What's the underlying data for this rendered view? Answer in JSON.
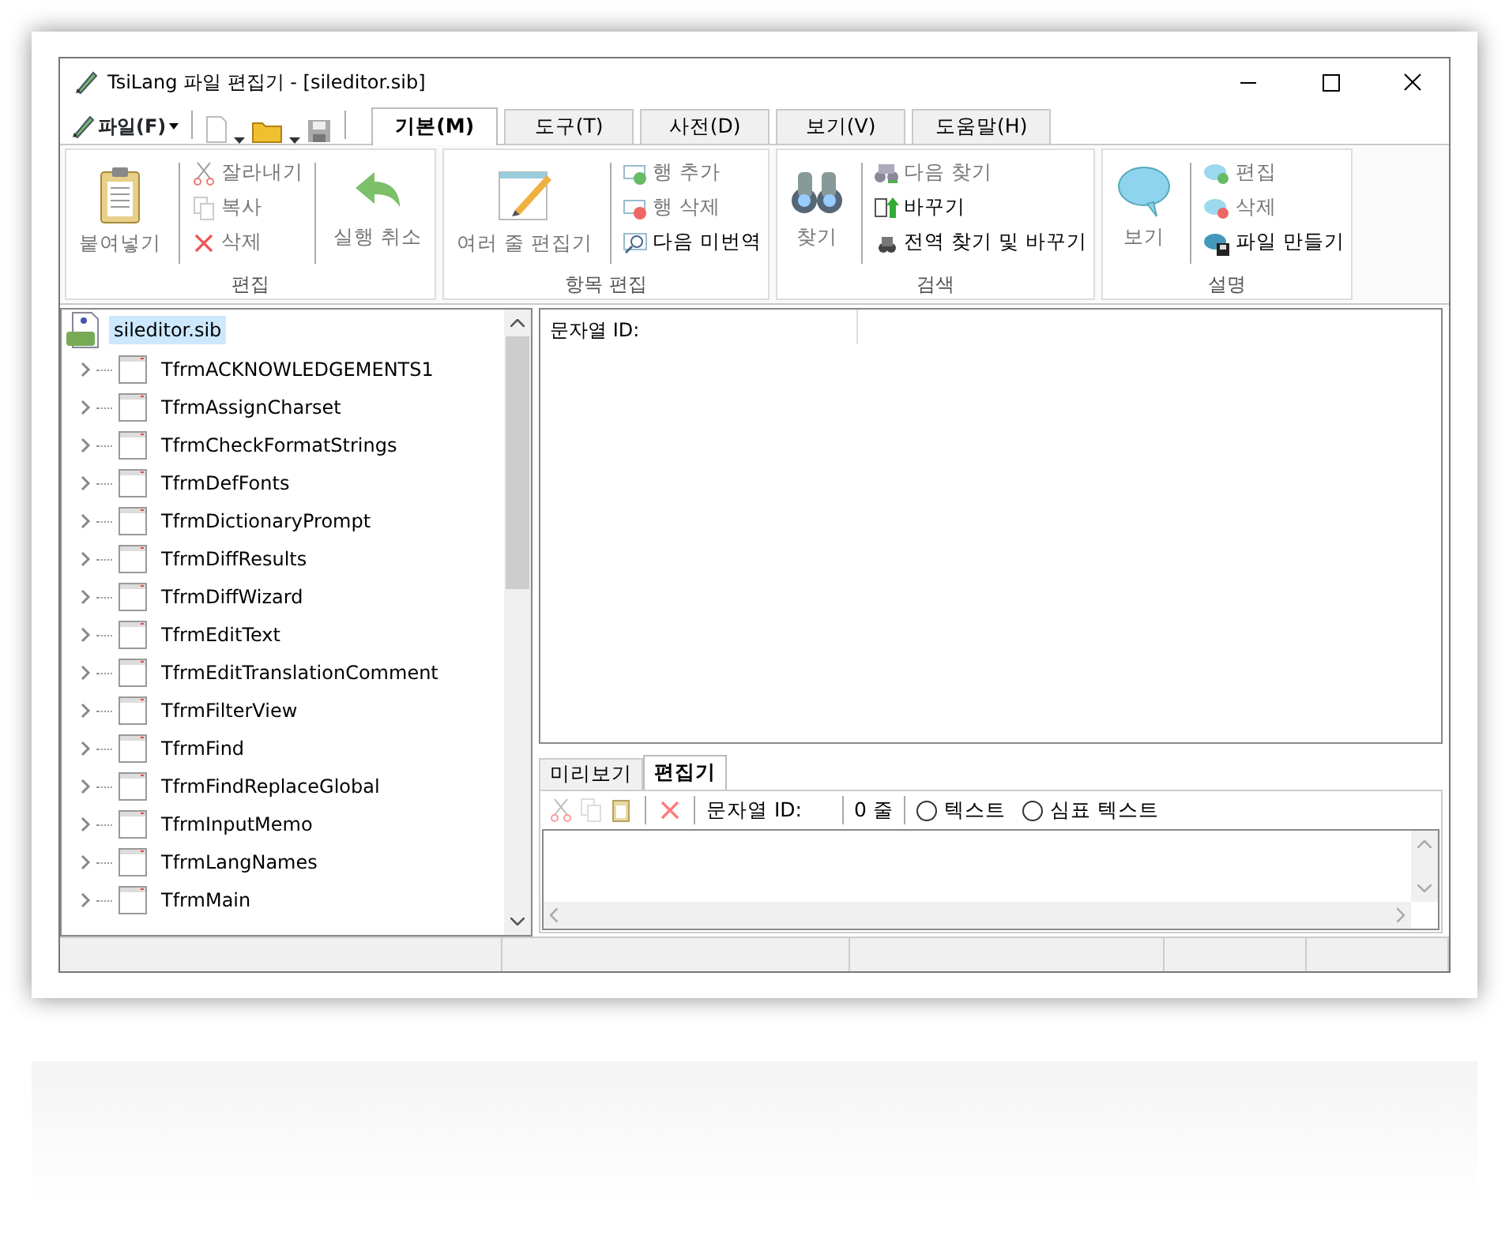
{
  "window": {
    "title": "TsiLang 파일 편집기 - [sileditor.sib]"
  },
  "file_menu": {
    "label": "파일(F)"
  },
  "ribbon_tabs": [
    {
      "label": "기본(M)",
      "selected": true
    },
    {
      "label": "도구(T)",
      "selected": false
    },
    {
      "label": "사전(D)",
      "selected": false
    },
    {
      "label": "보기(V)",
      "selected": false
    },
    {
      "label": "도움말(H)",
      "selected": false
    }
  ],
  "ribbon_groups": [
    {
      "title": "편집",
      "items": [
        {
          "kind": "large",
          "label": "붙여넣기",
          "disabled": true
        },
        {
          "kind": "small",
          "label": "잘라내기",
          "disabled": true
        },
        {
          "kind": "small",
          "label": "복사",
          "disabled": true
        },
        {
          "kind": "small",
          "label": "삭제",
          "disabled": true
        },
        {
          "kind": "large",
          "label": "실행 취소",
          "disabled": true
        }
      ]
    },
    {
      "title": "항목 편집",
      "items": [
        {
          "kind": "large",
          "label": "여러 줄 편집기",
          "disabled": true
        },
        {
          "kind": "small",
          "label": "행 추가",
          "disabled": true
        },
        {
          "kind": "small",
          "label": "행 삭제",
          "disabled": true
        },
        {
          "kind": "small",
          "label": "다음 미번역",
          "disabled": false
        }
      ]
    },
    {
      "title": "검색",
      "items": [
        {
          "kind": "large",
          "label": "찾기",
          "disabled": true
        },
        {
          "kind": "small",
          "label": "다음 찾기",
          "disabled": true
        },
        {
          "kind": "small",
          "label": "바꾸기",
          "disabled": false
        },
        {
          "kind": "small",
          "label": "전역 찾기 및 바꾸기",
          "disabled": false
        }
      ]
    },
    {
      "title": "설명",
      "items": [
        {
          "kind": "large",
          "label": "보기",
          "disabled": true
        },
        {
          "kind": "small",
          "label": "편집",
          "disabled": true
        },
        {
          "kind": "small",
          "label": "삭제",
          "disabled": true
        },
        {
          "kind": "small",
          "label": "파일 만들기",
          "disabled": false
        }
      ]
    }
  ],
  "tree": {
    "label": "sileditor.sib",
    "selected": true,
    "children": [
      {
        "label": "TfrmACKNOWLEDGEMENTS1",
        "expanded": false
      },
      {
        "label": "TfrmAssignCharset",
        "expanded": false
      },
      {
        "label": "TfrmCheckFormatStrings",
        "expanded": false
      },
      {
        "label": "TfrmDefFonts",
        "expanded": false
      },
      {
        "label": "TfrmDictionaryPrompt",
        "expanded": false
      },
      {
        "label": "TfrmDiffResults",
        "expanded": false
      },
      {
        "label": "TfrmDiffWizard",
        "expanded": false
      },
      {
        "label": "TfrmEditText",
        "expanded": false
      },
      {
        "label": "TfrmEditTranslationComment",
        "expanded": false
      },
      {
        "label": "TfrmFilterView",
        "expanded": false
      },
      {
        "label": "TfrmFind",
        "expanded": false
      },
      {
        "label": "TfrmFindReplaceGlobal",
        "expanded": false
      },
      {
        "label": "TfrmInputMemo",
        "expanded": false
      },
      {
        "label": "TfrmLangNames",
        "expanded": false
      },
      {
        "label": "TfrmMain",
        "expanded": false
      }
    ]
  },
  "grid": {
    "columns": [
      "문자열 ID:"
    ]
  },
  "bottom_tabs": [
    {
      "label": "미리보기",
      "selected": false
    },
    {
      "label": "편집기",
      "selected": true
    }
  ],
  "editor_toolbar": {
    "id_label": "문자열 ID:",
    "line_count": "0 줄",
    "radios": [
      {
        "label": "텍스트",
        "checked": false
      },
      {
        "label": "심표 텍스트",
        "checked": false
      }
    ]
  }
}
